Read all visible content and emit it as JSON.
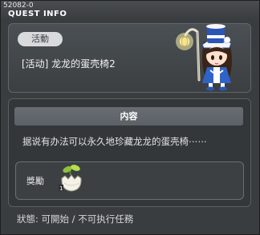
{
  "header": {
    "quest_id": "52082-0",
    "title": "QUEST INFO"
  },
  "quest": {
    "category": "活動",
    "name": "[活动] 龙龙的蛋壳椅2",
    "npc_icon": "npc-girl-with-lantern-staff"
  },
  "content": {
    "header": "内容",
    "description": "据说有办法可以永久地珍藏龙龙的蛋壳椅⋯⋯"
  },
  "reward": {
    "label": "獎勵",
    "item_icon": "egg-shell-chair-icon"
  },
  "status": {
    "text": "狀態: 可開始 / 不可执行任務"
  }
}
